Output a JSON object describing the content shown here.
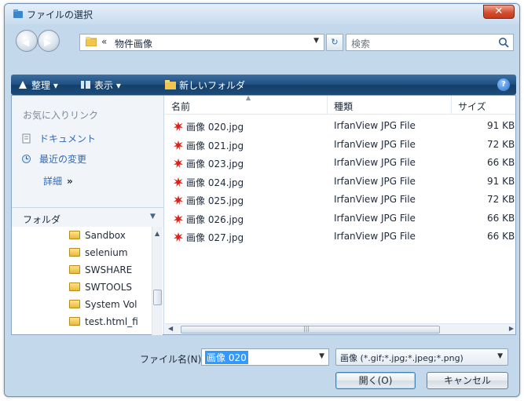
{
  "window": {
    "title": "ファイルの選択",
    "close_label": "✕"
  },
  "address": {
    "separator": "«",
    "path": "物件画像",
    "search_placeholder": "検索"
  },
  "toolbar": {
    "organize_label": "整理",
    "view_label": "表示",
    "new_folder_label": "新しいフォルダ",
    "help_label": "?"
  },
  "favorites": {
    "title": "お気に入りリンク",
    "items": [
      {
        "label": "ドキュメント",
        "icon": "document-icon"
      },
      {
        "label": "最近の変更",
        "icon": "recent-icon"
      }
    ],
    "details_label": "詳細",
    "details_arrow": "»"
  },
  "folders": {
    "title": "フォルダ",
    "items": [
      "Sandbox",
      "selenium",
      "SWSHARE",
      "SWTOOLS",
      "System Vol",
      "test.html_fi"
    ]
  },
  "file_list": {
    "columns": [
      "名前",
      "種類",
      "サイズ"
    ],
    "rows": [
      {
        "name": "画像 020.jpg",
        "type": "IrfanView JPG File",
        "size": "91 KB"
      },
      {
        "name": "画像 021.jpg",
        "type": "IrfanView JPG File",
        "size": "72 KB"
      },
      {
        "name": "画像 023.jpg",
        "type": "IrfanView JPG File",
        "size": "66 KB"
      },
      {
        "name": "画像 024.jpg",
        "type": "IrfanView JPG File",
        "size": "91 KB"
      },
      {
        "name": "画像 025.jpg",
        "type": "IrfanView JPG File",
        "size": "72 KB"
      },
      {
        "name": "画像 026.jpg",
        "type": "IrfanView JPG File",
        "size": "66 KB"
      },
      {
        "name": "画像 027.jpg",
        "type": "IrfanView JPG File",
        "size": "66 KB"
      }
    ]
  },
  "footer": {
    "filename_label": "ファイル名(N):",
    "filename_value": "画像 020",
    "filetype_value": "画像 (*.gif;*.jpg;*.jpeg;*.png)",
    "open_label": "開く(O)",
    "cancel_label": "キャンセル"
  },
  "colors": {
    "toolbar": "#1f4f80",
    "link": "#3069b8",
    "selection": "#3399ff",
    "file_icon": "#e0201a"
  }
}
